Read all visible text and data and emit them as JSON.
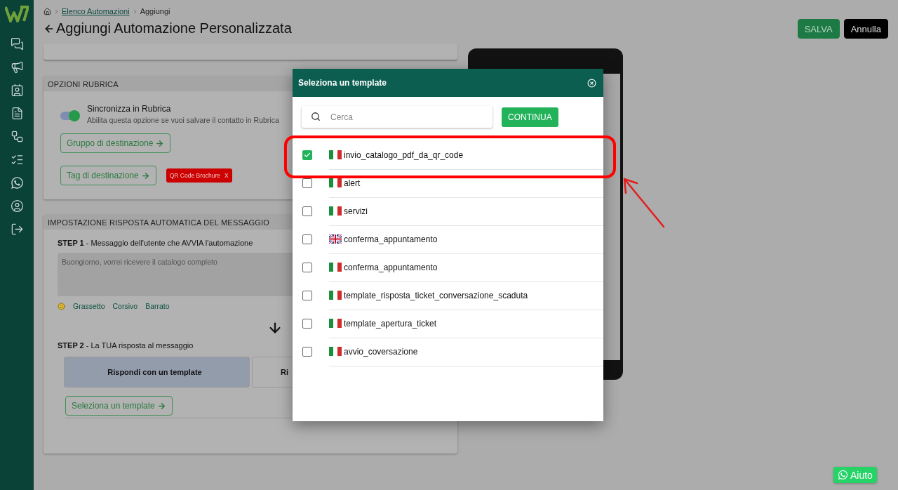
{
  "breadcrumb": {
    "link": "Elenco Automazioni",
    "current": "Aggiungi"
  },
  "page_title": "Aggiungi Automazione Personalizzata",
  "header_buttons": [
    {
      "label": "SALVA",
      "kind": "primary"
    },
    {
      "label": "Annulla",
      "kind": "dark"
    }
  ],
  "contact_options": {
    "title": "OPZIONI RUBRICA",
    "sync": {
      "label": "Sincronizza in Rubrica",
      "description": "Abilita questa opzione se vuoi salvare il contatto in Rubrica",
      "on": true
    },
    "group_button": "Gruppo di destinazione",
    "tag_button": "Tag di destinazione",
    "tags": [
      {
        "label": "QR Code Brochure",
        "remove": "X"
      }
    ]
  },
  "auto_reply": {
    "title": "IMPOSTAZIONE RISPOSTA AUTOMATICA DEL MESSAGGIO",
    "step1": {
      "heading": "**STEP 1** - Messaggio dell'utente che AVVIA l'automazione",
      "value": "Buongiorno, vorrei ricevere il catalogo completo",
      "format_options": [
        "Grassetto",
        "Corsivo",
        "Barrato"
      ]
    },
    "step2": {
      "heading": "**STEP 2** - La TUA risposta al messaggio",
      "options": [
        {
          "label": "Rispondi con un template",
          "selected": true
        },
        {
          "label": "Ri",
          "selected": false
        }
      ],
      "select_button": "Seleziona un template"
    }
  },
  "modal": {
    "title": "Seleziona un template",
    "search": {
      "placeholder": "Cerca"
    },
    "continue": "CONTINUA",
    "templates": [
      {
        "name": "invio_catalogo_pdf_da_qr_code",
        "kind": "italy",
        "checked": true
      },
      {
        "name": "alert",
        "kind": "italy",
        "checked": false
      },
      {
        "name": "servizi",
        "kind": "italy",
        "checked": false
      },
      {
        "name": "conferma_appuntamento",
        "kind": "uk",
        "checked": false
      },
      {
        "name": "conferma_appuntamento",
        "kind": "italy",
        "checked": false
      },
      {
        "name": "template_risposta_ticket_conversazione_scaduta",
        "kind": "italy",
        "checked": false
      },
      {
        "name": "template_apertura_ticket",
        "kind": "italy",
        "checked": false
      },
      {
        "name": "avvio_coversazione",
        "kind": "italy",
        "checked": false
      }
    ]
  },
  "help_button": "Aiuto"
}
